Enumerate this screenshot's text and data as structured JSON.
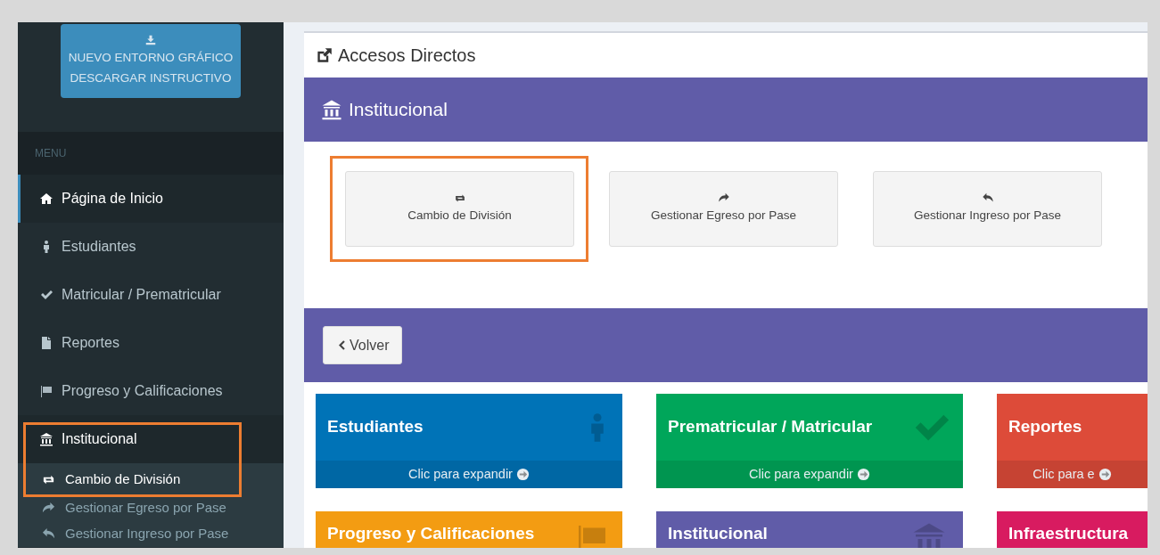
{
  "sidebar": {
    "download_button": {
      "lines": [
        "NUEVO ENTORNO GRÁFICO",
        "DESCARGAR INSTRUCTIVO"
      ]
    },
    "menu_header": "MENU",
    "items": [
      {
        "kind": "home",
        "label": "Página de Inicio",
        "selected": true
      },
      {
        "kind": "person",
        "label": "Estudiantes",
        "selected": false
      },
      {
        "kind": "check",
        "label": "Matricular / Prematricular",
        "selected": false
      },
      {
        "kind": "file",
        "label": "Reportes",
        "selected": false
      },
      {
        "kind": "flag",
        "label": "Progreso y Calificaciones",
        "selected": false
      },
      {
        "kind": "bank",
        "label": "Institucional",
        "selected": false,
        "expanded": true,
        "highlighted": true,
        "children": [
          {
            "kind": "swap",
            "label": "Cambio de División",
            "selected": true
          },
          {
            "kind": "forward",
            "label": "Gestionar Egreso por Pase",
            "selected": false
          },
          {
            "kind": "reply",
            "label": "Gestionar Ingreso por Pase",
            "selected": false
          }
        ]
      }
    ]
  },
  "main": {
    "title": "Accesos Directos",
    "section": {
      "title": "Institucional",
      "shortcuts": [
        {
          "kind": "swap",
          "label": "Cambio de División",
          "highlighted": true
        },
        {
          "kind": "forward",
          "label": "Gestionar Egreso por Pase",
          "highlighted": false
        },
        {
          "kind": "reply",
          "label": "Gestionar Ingreso por Pase",
          "highlighted": false
        }
      ]
    },
    "back_button": "Volver",
    "tiles": [
      {
        "title": "Estudiantes",
        "footer": "Clic para expandir",
        "color": "#0073b7",
        "kind": "person"
      },
      {
        "title": "Prematricular / Matricular",
        "footer": "Clic para expandir",
        "color": "#00a65a",
        "kind": "check"
      },
      {
        "title": "Reportes",
        "footer": "Clic para e",
        "color": "#dd4b39",
        "kind": "none"
      },
      {
        "title": "Progreso y Calificaciones",
        "color": "#f39c12",
        "kind": "flag"
      },
      {
        "title": "Institucional",
        "color": "#605ca8",
        "kind": "bank"
      },
      {
        "title": "Infraestructura",
        "color": "#d81b60",
        "kind": "none"
      }
    ]
  }
}
